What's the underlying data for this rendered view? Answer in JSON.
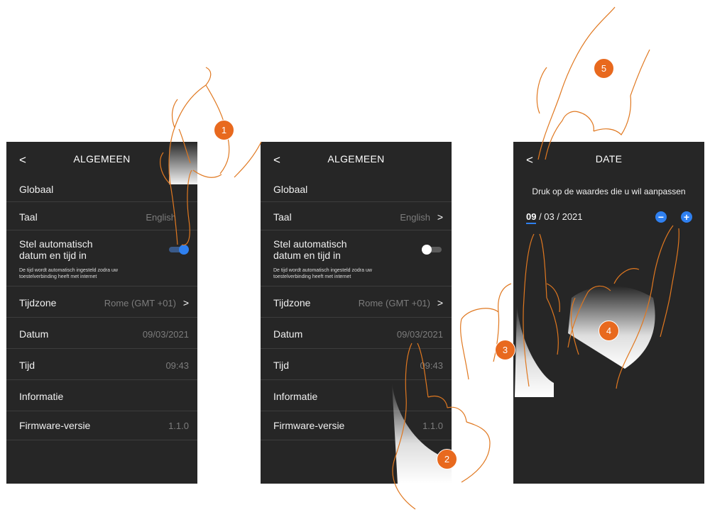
{
  "screen1": {
    "header": {
      "back_icon": "chevron-left-icon",
      "back": "<",
      "title": "ALGEMEEN"
    },
    "section_global": "Globaal",
    "language": {
      "label": "Taal",
      "value": "English"
    },
    "auto": {
      "label_line1": "Stel automatisch",
      "label_line2": "datum en tijd in",
      "note_line1": "De tijd wordt automatisch ingesteld zodra uw",
      "note_line2": "toestelverbinding heeft met internet",
      "toggle": "on"
    },
    "timezone": {
      "label": "Tijdzone",
      "value": "Rome (GMT +01)",
      "chevron": ">"
    },
    "date": {
      "label": "Datum",
      "value": "09/03/2021"
    },
    "time": {
      "label": "Tijd",
      "value": "09:43"
    },
    "info": {
      "label": "Informatie"
    },
    "firmware": {
      "label": "Firmware-versie",
      "value": "1.1.0"
    }
  },
  "screen2": {
    "header": {
      "back": "<",
      "title": "ALGEMEEN"
    },
    "section_global": "Globaal",
    "language": {
      "label": "Taal",
      "value": "English",
      "chevron": ">"
    },
    "auto": {
      "label_line1": "Stel automatisch",
      "label_line2": "datum en tijd in",
      "note_line1": "De tijd wordt automatisch ingesteld zodra uw",
      "note_line2": "toestelverbinding heeft met internet",
      "toggle": "off"
    },
    "timezone": {
      "label": "Tijdzone",
      "value": "Rome (GMT +01)",
      "chevron": ">"
    },
    "date": {
      "label": "Datum",
      "value": "09/03/2021"
    },
    "time": {
      "label": "Tijd",
      "value": "09:43"
    },
    "info": {
      "label": "Informatie"
    },
    "firmware": {
      "label": "Firmware-versie",
      "value": "1.1.0"
    }
  },
  "screen3": {
    "header": {
      "back": "<",
      "title": "DATE"
    },
    "instruction": "Druk op de waardes die u wil aanpassen",
    "date_day": "09",
    "date_rest": " / 03 / 2021",
    "minus": "−",
    "plus": "+"
  },
  "steps": [
    "1",
    "2",
    "3",
    "4",
    "5"
  ],
  "colors": {
    "screen_bg": "#262626",
    "accent": "#2f80f0",
    "badge": "#e8691e",
    "hand_outline": "#e07820"
  }
}
